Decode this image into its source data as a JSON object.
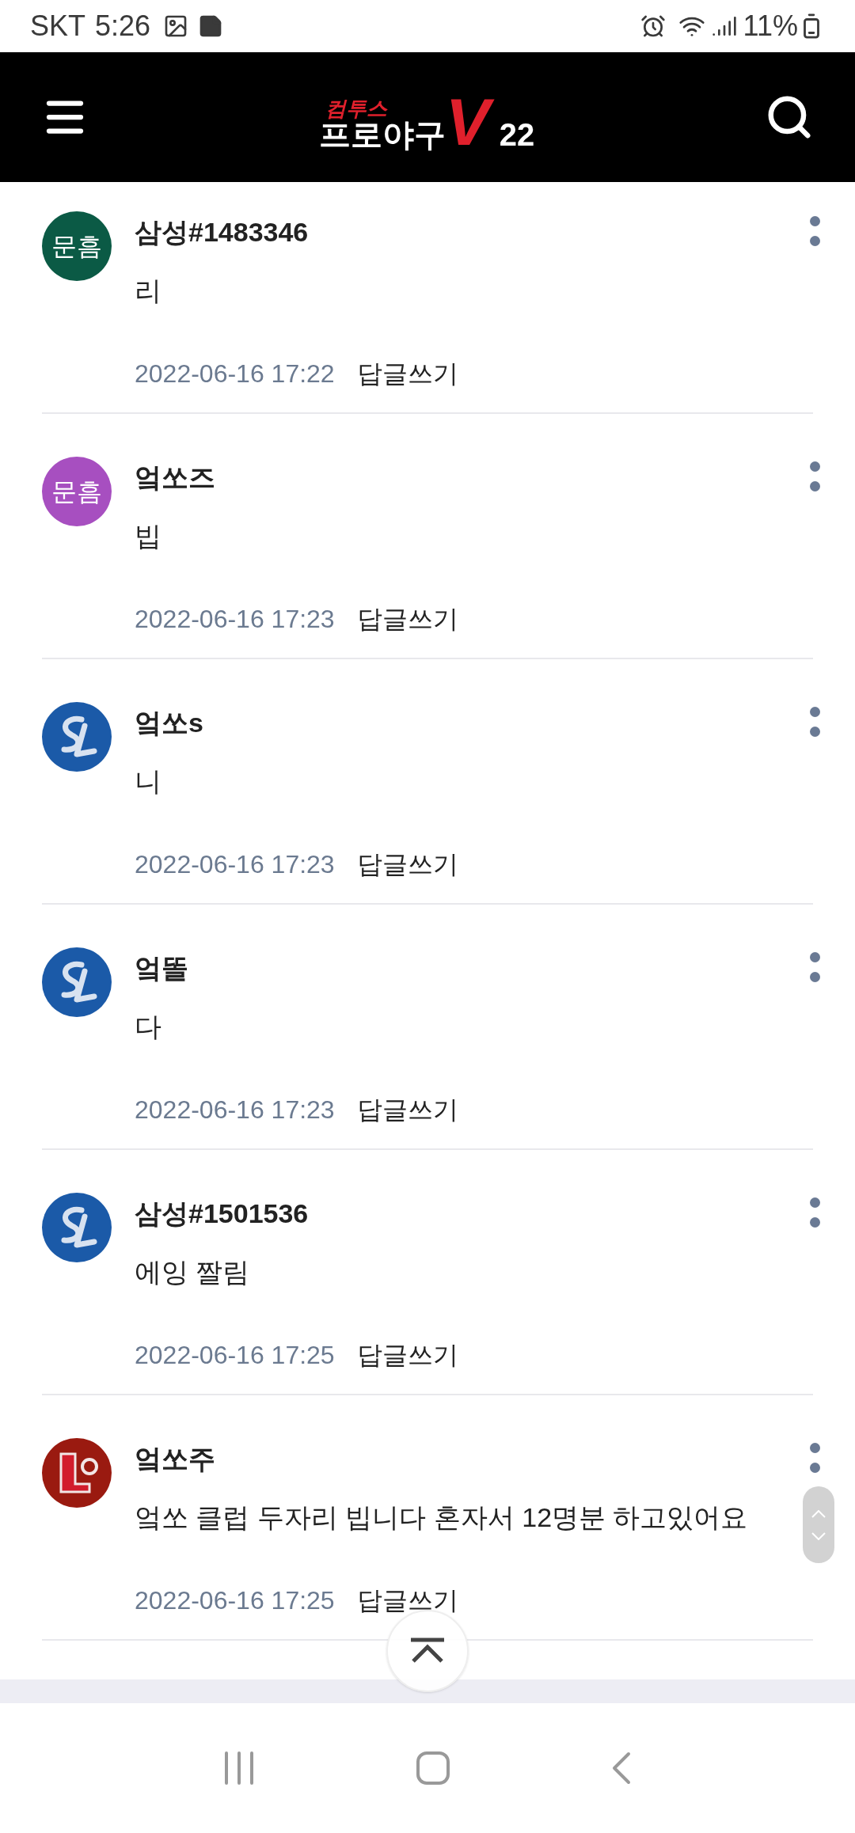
{
  "status_bar": {
    "carrier": "SKT",
    "time": "5:26",
    "battery": "11%"
  },
  "header": {
    "logo": {
      "brand": "컴투스",
      "title": "프로야구",
      "mark": "V",
      "number": "22"
    }
  },
  "comments": [
    {
      "avatar": {
        "kind": "text",
        "text": "문흠",
        "color": "#0b5a45"
      },
      "author": "삼성#1483346",
      "body": "리",
      "date": "2022-06-16 17:22",
      "reply": "답글쓰기"
    },
    {
      "avatar": {
        "kind": "text",
        "text": "문흠",
        "color": "#a74fc0"
      },
      "author": "엌쏘즈",
      "body": "빕",
      "date": "2022-06-16 17:23",
      "reply": "답글쓰기"
    },
    {
      "avatar": {
        "kind": "blue_logo"
      },
      "author": "엌쏘s",
      "body": "니",
      "date": "2022-06-16 17:23",
      "reply": "답글쓰기"
    },
    {
      "avatar": {
        "kind": "blue_logo"
      },
      "author": "엌똘",
      "body": "다",
      "date": "2022-06-16 17:23",
      "reply": "답글쓰기"
    },
    {
      "avatar": {
        "kind": "blue_logo"
      },
      "author": "삼성#1501536",
      "body": "에잉 짤림",
      "date": "2022-06-16 17:25",
      "reply": "답글쓰기"
    },
    {
      "avatar": {
        "kind": "red_logo"
      },
      "author": "엌쏘주",
      "body": "엌쏘 클럽 두자리 빕니다 혼자서 12명분 하고있어요",
      "date": "2022-06-16 17:25",
      "reply": "답글쓰기"
    }
  ]
}
